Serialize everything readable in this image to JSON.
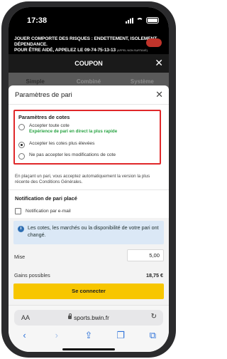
{
  "status": {
    "time": "17:38"
  },
  "banner": {
    "line1": "JOUER COMPORTE DES RISQUES : ENDETTEMENT, ISOLEMENT, DÉPENDANCE.",
    "line2": "POUR ÊTRE AIDÉ, APPELEZ LE 09-74-75-13-13",
    "line2_small": "(APPEL NON SURTAXÉ)"
  },
  "coupon": {
    "title": "COUPON"
  },
  "tabs": [
    "Simple",
    "Combiné",
    "Système"
  ],
  "modal": {
    "title": "Paramètres de pari",
    "odds_section": "Paramètres de cotes",
    "options": [
      {
        "label": "Accepter toute cote",
        "sub": "Expérience de pari en direct la plus rapide",
        "checked": false
      },
      {
        "label": "Accepter les cotes plus élevées",
        "sub": "",
        "checked": true
      },
      {
        "label": "Ne pas accepter les modifications de cote",
        "sub": "",
        "checked": false
      }
    ],
    "info": "En plaçant un pari, vous acceptez automatiquement la version la plus récente des Conditions Générales.",
    "notif_section": "Notification de pari placé",
    "email_label": "Notification par e-mail"
  },
  "alert": {
    "text": "Les cotes, les marchés ou la disponibilité de votre pari ont changé."
  },
  "stake": {
    "label": "Mise",
    "value": "5,00"
  },
  "gains": {
    "label": "Gains possibles",
    "value": "18,75 €"
  },
  "connect_label": "Se connecter",
  "safari": {
    "aa": "AA",
    "url": "sports.bwin.fr"
  },
  "colors": {
    "accent": "#f7c600",
    "highlight_border": "#e0282a",
    "info_bg": "#dbe8f6",
    "success": "#29a343"
  }
}
